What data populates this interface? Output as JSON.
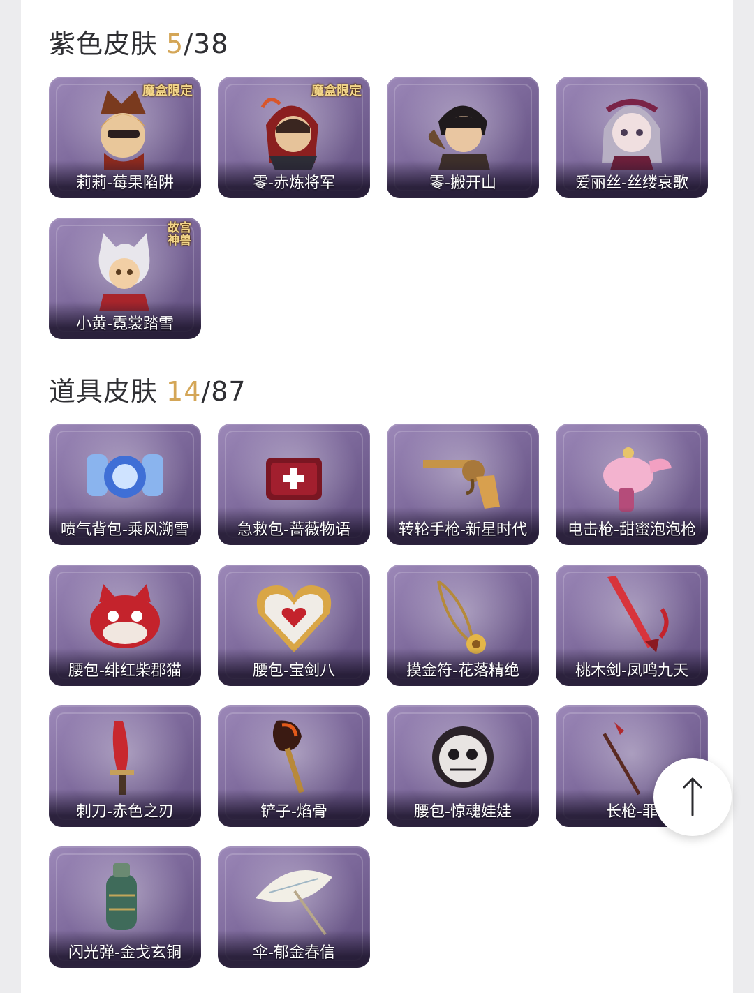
{
  "sections": [
    {
      "title": "紫色皮肤",
      "owned": "5",
      "sep": "/",
      "total": "38",
      "items": [
        {
          "label": "莉莉-莓果陷阱",
          "badge": "魔盒限定"
        },
        {
          "label": "零-赤炼将军",
          "badge": "魔盒限定"
        },
        {
          "label": "零-搬开山",
          "badge": ""
        },
        {
          "label": "爱丽丝-丝缕哀歌",
          "badge": ""
        },
        {
          "label": "小黄-霓裳踏雪",
          "badge": "故宫神兽"
        }
      ]
    },
    {
      "title": "道具皮肤",
      "owned": "14",
      "sep": "/",
      "total": "87",
      "items": [
        {
          "label": "喷气背包-乘风溯雪"
        },
        {
          "label": "急救包-蔷薇物语"
        },
        {
          "label": "转轮手枪-新星时代"
        },
        {
          "label": "电击枪-甜蜜泡泡枪"
        },
        {
          "label": "腰包-绯红柴郡猫"
        },
        {
          "label": "腰包-宝剑八"
        },
        {
          "label": "摸金符-花落精绝"
        },
        {
          "label": "桃木剑-凤鸣九天"
        },
        {
          "label": "刺刀-赤色之刃"
        },
        {
          "label": "铲子-焰骨"
        },
        {
          "label": "腰包-惊魂娃娃"
        },
        {
          "label": "长枪-罪"
        },
        {
          "label": "闪光弹-金戈玄铜"
        },
        {
          "label": "伞-郁金春信"
        }
      ]
    }
  ],
  "scroll_top": {
    "icon": "arrow-up-icon"
  },
  "colors": {
    "owned": "#d4a657",
    "card": "#7e6a9c"
  }
}
